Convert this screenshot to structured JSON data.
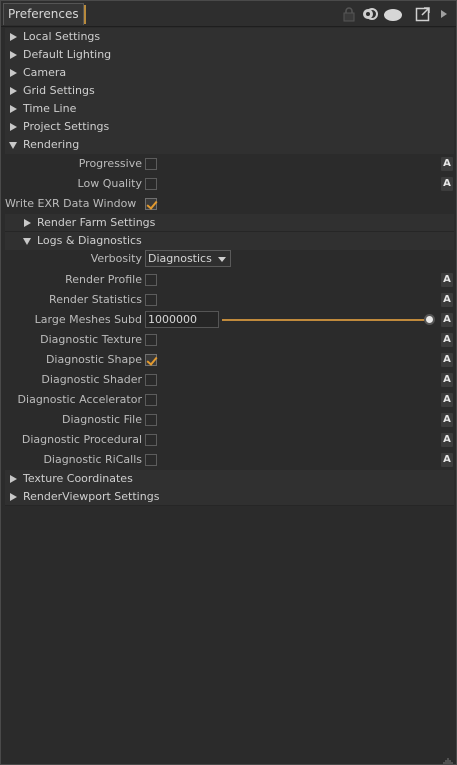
{
  "titlebar": {
    "tab_label": "Preferences",
    "icons": [
      "lock-icon",
      "link-icon",
      "toggle-icon",
      "popout-icon",
      "menu-arrow-icon"
    ]
  },
  "sections_top": [
    {
      "label": "Local Settings",
      "expanded": false
    },
    {
      "label": "Default Lighting",
      "expanded": false
    },
    {
      "label": "Camera",
      "expanded": false
    },
    {
      "label": "Grid Settings",
      "expanded": false
    },
    {
      "label": "Time Line",
      "expanded": false
    },
    {
      "label": "Project Settings",
      "expanded": false
    },
    {
      "label": "Rendering",
      "expanded": true
    }
  ],
  "rendering": {
    "progressive": {
      "label": "Progressive",
      "checked": false,
      "a_label": "A"
    },
    "low_quality": {
      "label": "Low Quality",
      "checked": false,
      "a_label": "A"
    },
    "write_exr": {
      "label": "Write EXR Data Window",
      "checked": true
    },
    "render_farm": {
      "label": "Render Farm Settings",
      "expanded": false
    },
    "logs": {
      "label": "Logs & Diagnostics",
      "expanded": true
    },
    "verbosity": {
      "label": "Verbosity",
      "value": "Diagnostics"
    },
    "render_profile": {
      "label": "Render Profile",
      "checked": false,
      "a_label": "A"
    },
    "render_statistics": {
      "label": "Render Statistics",
      "checked": false,
      "a_label": "A"
    },
    "large_meshes": {
      "label": "Large Meshes Subd",
      "value": "1000000",
      "a_label": "A"
    },
    "diagnostics": [
      {
        "label": "Diagnostic Texture",
        "checked": false,
        "a_label": "A"
      },
      {
        "label": "Diagnostic Shape",
        "checked": true,
        "a_label": "A"
      },
      {
        "label": "Diagnostic Shader",
        "checked": false,
        "a_label": "A"
      },
      {
        "label": "Diagnostic Accelerator",
        "checked": false,
        "a_label": "A"
      },
      {
        "label": "Diagnostic File",
        "checked": false,
        "a_label": "A"
      },
      {
        "label": "Diagnostic Procedural",
        "checked": false,
        "a_label": "A"
      },
      {
        "label": "Diagnostic RiCalls",
        "checked": false,
        "a_label": "A"
      }
    ]
  },
  "sections_bottom": [
    {
      "label": "Texture Coordinates",
      "expanded": false
    },
    {
      "label": "RenderViewport Settings",
      "expanded": false
    }
  ],
  "colors": {
    "accent": "#e39a2e",
    "background": "#2b2b2b",
    "section": "#303030"
  }
}
